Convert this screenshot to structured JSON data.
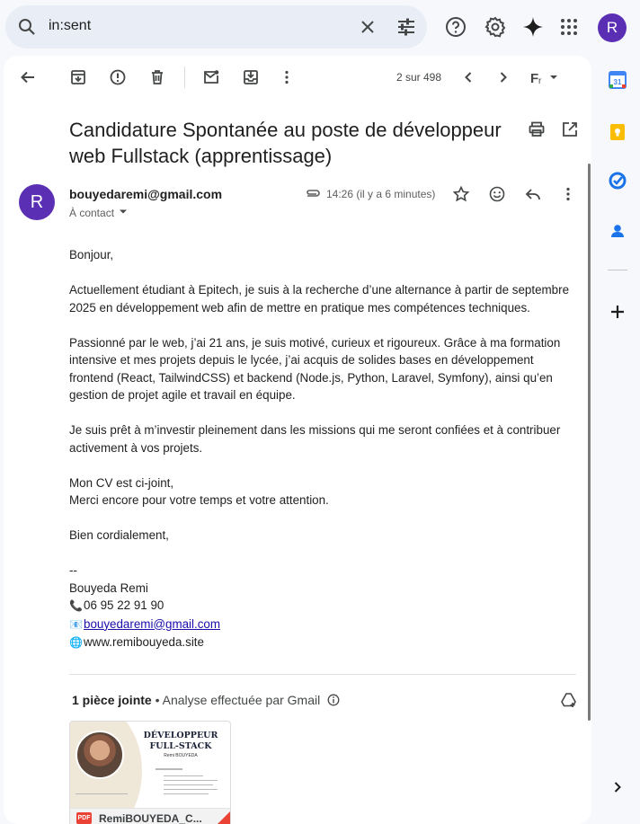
{
  "search": {
    "value": "in:sent"
  },
  "header": {
    "avatar_letter": "R"
  },
  "toolbar": {
    "pager": "2 sur 498"
  },
  "email": {
    "subject": "Candidature Spontanée au poste de développeur web Fullstack (apprentissage)",
    "avatar_letter": "R",
    "sender": "bouyedaremi@gmail.com",
    "to": "À contact",
    "time": "14:26 (il y a 6 minutes)",
    "body": {
      "greeting": "Bonjour,",
      "p1": "Actuellement étudiant à Epitech, je suis à la recherche d’une alternance à partir de septembre 2025 en développement web afin de mettre en pratique mes compétences techniques.",
      "p2": "Passionné par le web, j’ai 21 ans, je suis motivé, curieux et rigoureux. Grâce à ma formation intensive et mes projets depuis le lycée, j’ai acquis de solides bases en développement frontend (React, TailwindCSS) et backend (Node.js, Python, Laravel, Symfony), ainsi qu’en gestion de projet agile et travail en équipe.",
      "p3": "Je suis prêt à m’investir pleinement dans les missions qui me seront confiées et à contribuer activement à vos projets.",
      "p4a": "Mon CV est ci-joint,",
      "p4b": "Merci encore pour votre temps et votre attention.",
      "closing": "Bien cordialement,",
      "sig_sep": "--",
      "sig_name": "Bouyeda Remi",
      "sig_phone": "06 95 22 91 90",
      "sig_email": "bouyedaremi@gmail.com",
      "sig_site": "www.remibouyeda.site"
    }
  },
  "attachments": {
    "count_label": "1 pièce jointe",
    "scan_label": "• Analyse effectuée par Gmail",
    "file": {
      "type": "PDF",
      "name": "RemiBOUYEDA_CV.pdf",
      "display_name": "RemiBOUYEDA_C...",
      "preview_title_line1": "DÉVELOPPEUR",
      "preview_title_line2": "FULL-STACK",
      "preview_name": "Remi BOUYEDA"
    }
  },
  "side_panel": {
    "calendar_day": "31",
    "icons": [
      "calendar-icon",
      "keep-icon",
      "tasks-icon",
      "contacts-icon",
      "add-icon",
      "expand-icon"
    ]
  },
  "colors": {
    "accent": "#0b57d0",
    "avatar": "#5b2fb3",
    "pdf_red": "#ea4335"
  }
}
